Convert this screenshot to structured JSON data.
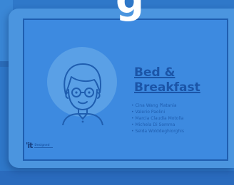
{
  "header": {
    "heading": "g"
  },
  "slide": {
    "title_line1": "Bed &",
    "title_line2": "Breakfast",
    "members": [
      "Cina Wang Platania",
      "Valerio Paolini",
      "Marcia Claudia Motolla",
      "Michela Di Somma",
      "Selda Wolddeghiorghis"
    ],
    "logo": {
      "mark": "'it",
      "name": "Designed"
    }
  },
  "colors": {
    "background": "#2f78c9",
    "tablet": "#4b95df",
    "slide": "#3d8ae0",
    "accent": "#1b55a8",
    "heading": "#ffffff"
  },
  "icons": [
    "laptop-icon",
    "tablet-icon",
    "avatar-icon"
  ]
}
